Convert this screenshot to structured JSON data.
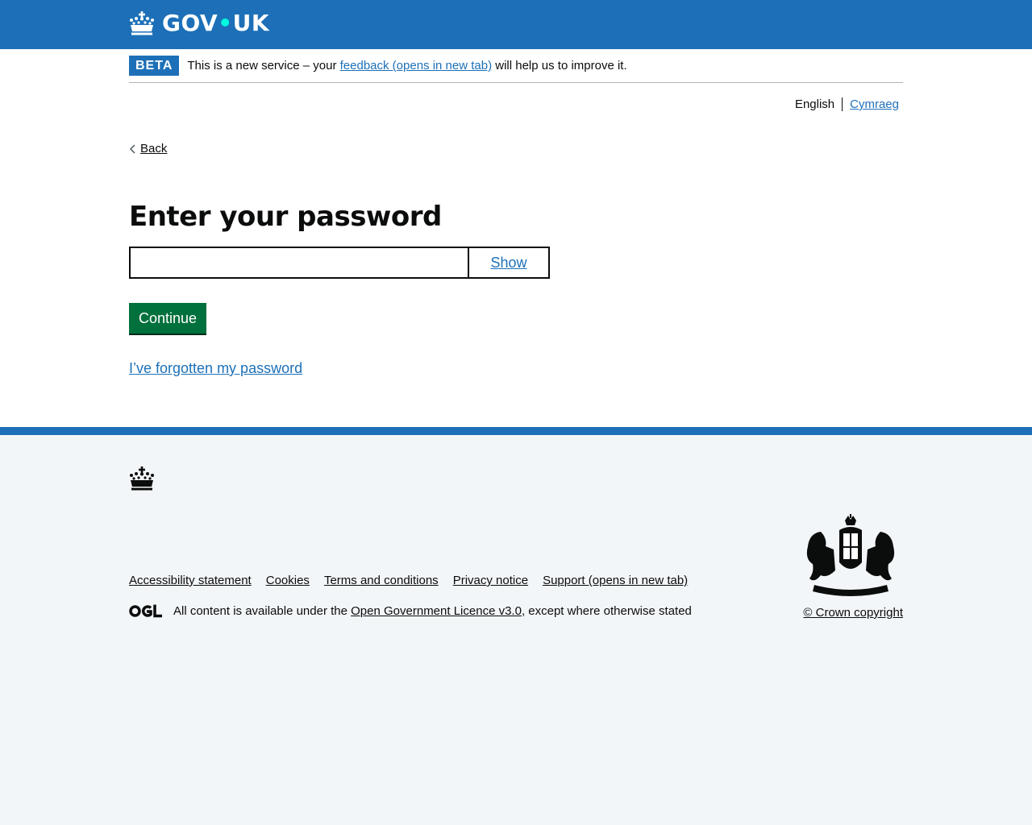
{
  "header": {
    "logo_text_left": "GOV",
    "logo_dot": "•",
    "logo_text_right": "UK",
    "crown_icon": "crown-icon",
    "bg_color": "#1d70b8"
  },
  "phase_banner": {
    "tag": "BETA",
    "text_before": "This is a new service – your ",
    "link": "feedback (opens in new tab)",
    "text_after": " will help us to improve it."
  },
  "language": {
    "current": "English",
    "other": "Cymraeg"
  },
  "back_link": "Back",
  "form": {
    "heading": "Enter your password",
    "password_value": "",
    "show_button": "Show",
    "continue_button": "Continue",
    "continue_color": "#00703c",
    "forgot_link": "I’ve forgotten my password"
  },
  "footer": {
    "links": [
      "Accessibility statement",
      "Cookies",
      "Terms and conditions",
      "Privacy notice",
      "Support (opens in new tab)"
    ],
    "licence_prefix": "All content is available under the ",
    "licence_link": "Open Government Licence v3.0",
    "licence_suffix": ", except where otherwise stated",
    "ogl_icon": "ogl-icon",
    "arms_icon": "royal-coat-of-arms-icon",
    "copyright": "© Crown copyright"
  }
}
